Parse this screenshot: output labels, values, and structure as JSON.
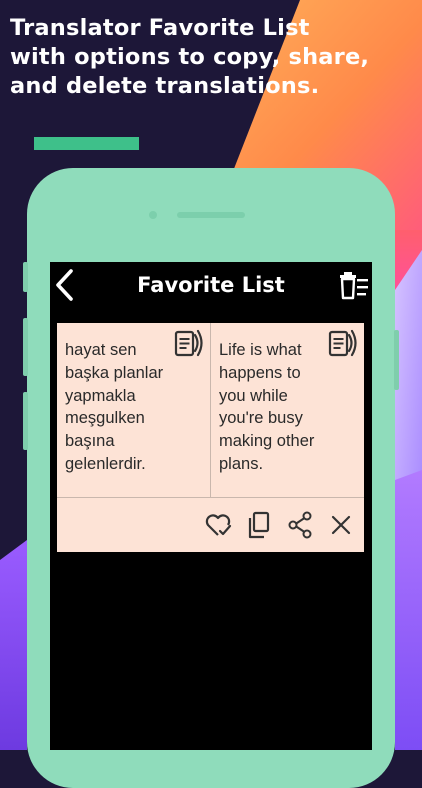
{
  "caption": "Translator Favorite List\nwith options to copy, share,\nand delete translations.",
  "colors": {
    "background": "#1d1738",
    "phone": "#8fdcbb",
    "accent_bar": "#3ec08a",
    "card": "#fde3d6",
    "screen": "#000000"
  },
  "header": {
    "title": "Favorite List",
    "back_icon": "chevron-left-icon",
    "delete_all_icon": "delete-list-icon"
  },
  "favorite": {
    "source_text": "hayat sen\nbaşka planlar\nyapmakla\nmeşgulken\nbaşına\ngelenlerdir.",
    "target_text": "Life is what\nhappens to\nyou while\nyou're busy\nmaking other\nplans.",
    "actions": [
      "heart-check-icon",
      "copy-icon",
      "share-icon",
      "close-icon"
    ]
  }
}
